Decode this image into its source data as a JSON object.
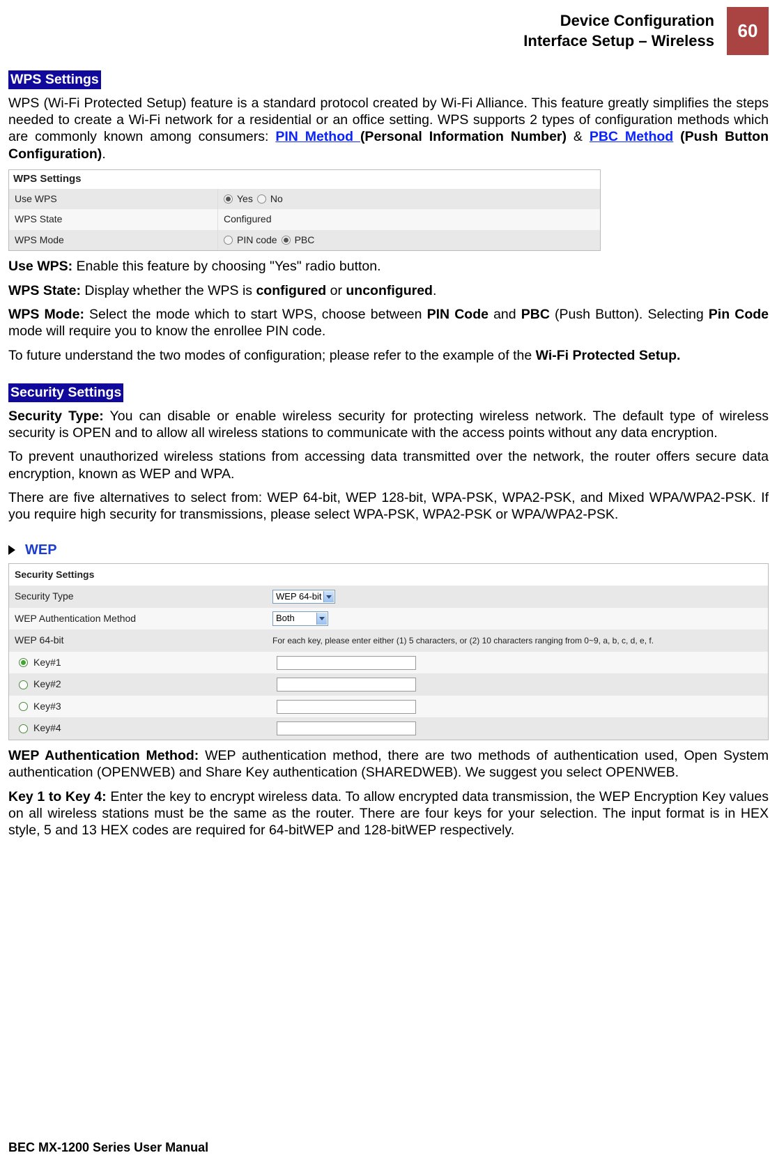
{
  "header": {
    "title_line1": "Device Configuration",
    "title_line2": "Interface Setup – Wireless",
    "page_number": "60"
  },
  "wps": {
    "section_label": "WPS Settings",
    "intro_part1": "WPS (Wi-Fi Protected Setup) feature is a standard protocol created by Wi-Fi Alliance. This feature greatly simplifies the steps needed to create a Wi-Fi network for a residential or an office setting. WPS supports 2 types of configuration methods which are commonly known among consumers: ",
    "pin_link": "PIN Method ",
    "intro_part2": "(Personal Information Number)",
    "amp": " & ",
    "pbc_link": "PBC Method",
    "intro_part3": " (Push Button Configuration)",
    "period": ".",
    "screenshot": {
      "title": "WPS Settings",
      "rows": [
        {
          "label": "Use WPS",
          "type": "radio_yesno",
          "yes": "Yes",
          "no": "No",
          "selected": "yes"
        },
        {
          "label": "WPS State",
          "type": "text",
          "value": "Configured"
        },
        {
          "label": "WPS Mode",
          "type": "radio_mode",
          "pin": "PIN code",
          "pbc": "PBC",
          "selected": "pbc"
        }
      ]
    },
    "use_wps_b": "Use WPS:",
    "use_wps_t": " Enable this feature by choosing \"Yes\" radio button.",
    "wps_state_b": "WPS State:",
    "wps_state_t1": " Display whether the WPS is ",
    "wps_state_c": "configured",
    "wps_state_or": " or ",
    "wps_state_u": "unconfigured",
    "wps_state_end": ".",
    "wps_mode_b": "WPS Mode:",
    "wps_mode_t1": " Select the mode which to start WPS, choose between ",
    "wps_mode_pin": "PIN Code",
    "wps_mode_and": " and ",
    "wps_mode_pbc": "PBC",
    "wps_mode_t2": " (Push Button). Selecting ",
    "wps_mode_pin2": "Pin Code",
    "wps_mode_t3": " mode will require you to know the enrollee PIN code.",
    "future_t1": "To future understand the two modes of configuration; please refer to the example of the ",
    "future_b": "Wi-Fi Protected Setup."
  },
  "security": {
    "section_label": "Security Settings",
    "sectype_b": "Security Type:",
    "sectype_t": " You can disable or enable wireless security for protecting wireless network. The default type of wireless security is OPEN and to allow all wireless stations to communicate with the access points without any data encryption.",
    "para2": "To prevent unauthorized wireless stations from accessing data transmitted over the network, the router offers secure data encryption, known as WEP and WPA.",
    "para3": "There are five alternatives to select from: WEP 64-bit, WEP 128-bit, WPA-PSK, WPA2-PSK, and Mixed WPA/WPA2-PSK. If you require high security for transmissions, please select WPA-PSK, WPA2-PSK or WPA/WPA2-PSK.",
    "wep_title": "WEP",
    "screenshot": {
      "title": "Security Settings",
      "security_type_label": "Security Type",
      "security_type_value": "WEP 64-bit",
      "wep_auth_label": "WEP Authentication Method",
      "wep_auth_value": "Both",
      "wep64_label": "WEP 64-bit",
      "wep64_note": "For each key, please enter either (1) 5 characters, or (2) 10 characters ranging from 0~9, a, b, c, d, e, f.",
      "keys": [
        "Key#1",
        "Key#2",
        "Key#3",
        "Key#4"
      ],
      "selected_key_idx": 0
    },
    "wep_auth_b": "WEP Authentication Method:",
    "wep_auth_t": " WEP authentication method, there are two methods of authentication used, Open System authentication (OPENWEB) and Share Key authentication (SHAREDWEB). We suggest you select OPENWEB.",
    "key_b": "Key 1 to Key 4:",
    "key_t": " Enter the key to encrypt wireless data. To allow encrypted data transmission, the WEP Encryption Key values on all wireless stations must be the same as the router. There are four keys for your selection. The input format is in HEX style, 5 and 13 HEX codes are required for 64-bitWEP and 128-bitWEP respectively."
  },
  "footer": "BEC MX-1200 Series User Manual"
}
